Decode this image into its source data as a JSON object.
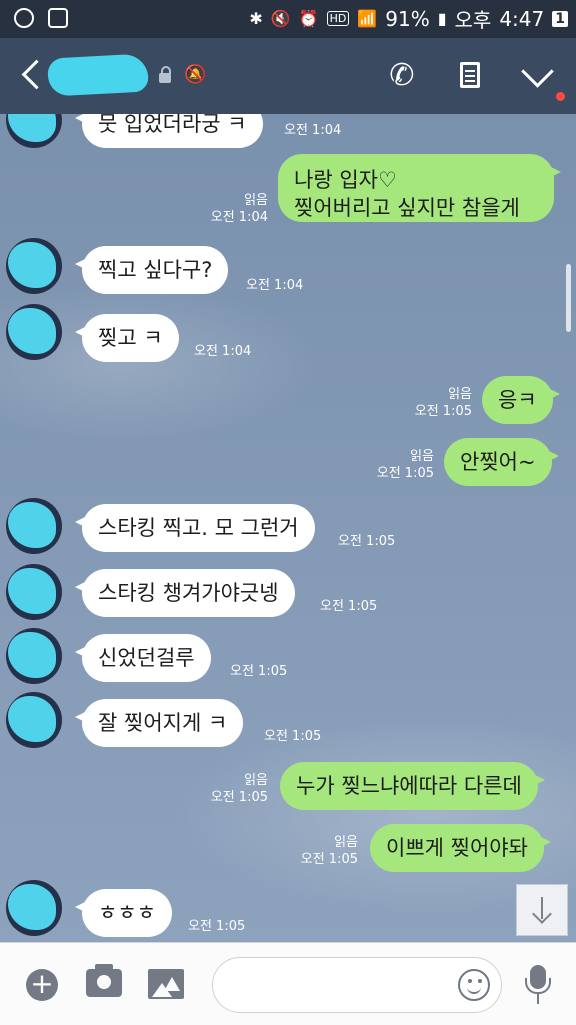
{
  "status": {
    "battery": "91%",
    "ampm": "오후",
    "time": "4:47",
    "notif_count": "1",
    "hd": "HD"
  },
  "header": {
    "contact_name": "",
    "has_new_indicator": true
  },
  "messages": [
    {
      "side": "in",
      "text": "뭇 입었더라궁 ㅋ",
      "time": "오전 1:04",
      "read": ""
    },
    {
      "side": "out",
      "text_line1": "나랑 입자♡",
      "text_line2": "찢어버리고 싶지만 참을게",
      "time": "오전 1:04",
      "read": "읽음"
    },
    {
      "side": "in",
      "text": "찍고 싶다구?",
      "time": "오전 1:04",
      "read": ""
    },
    {
      "side": "in",
      "text": "찢고 ㅋ",
      "time": "오전 1:04",
      "read": ""
    },
    {
      "side": "out",
      "text": "응ㅋ",
      "time": "오전 1:05",
      "read": "읽음"
    },
    {
      "side": "out",
      "text": "안찢어~",
      "time": "오전 1:05",
      "read": "읽음"
    },
    {
      "side": "in",
      "text": "스타킹 찍고. 모 그런거",
      "time": "오전 1:05",
      "read": ""
    },
    {
      "side": "in",
      "text": "스타킹 챙겨가야긋넹",
      "time": "오전 1:05",
      "read": ""
    },
    {
      "side": "in",
      "text": "신었던걸루",
      "time": "오전 1:05",
      "read": ""
    },
    {
      "side": "in",
      "text": "잘 찢어지게 ㅋ",
      "time": "오전 1:05",
      "read": ""
    },
    {
      "side": "out",
      "text": "누가 찢느냐에따라 다른데",
      "time": "오전 1:05",
      "read": "읽음"
    },
    {
      "side": "out",
      "text": "이쁘게 찢어야돠",
      "time": "오전 1:05",
      "read": "읽음"
    },
    {
      "side": "in",
      "text": "ㅎㅎㅎ",
      "time": "오전 1:05",
      "read": ""
    }
  ],
  "input": {
    "placeholder": ""
  },
  "icons": [
    "back-icon",
    "lock-icon",
    "mute-icon",
    "phone-icon",
    "document-icon",
    "chevron-down-icon",
    "plus-icon",
    "camera-icon",
    "image-icon",
    "emoji-icon",
    "mic-icon",
    "scroll-down-icon"
  ]
}
